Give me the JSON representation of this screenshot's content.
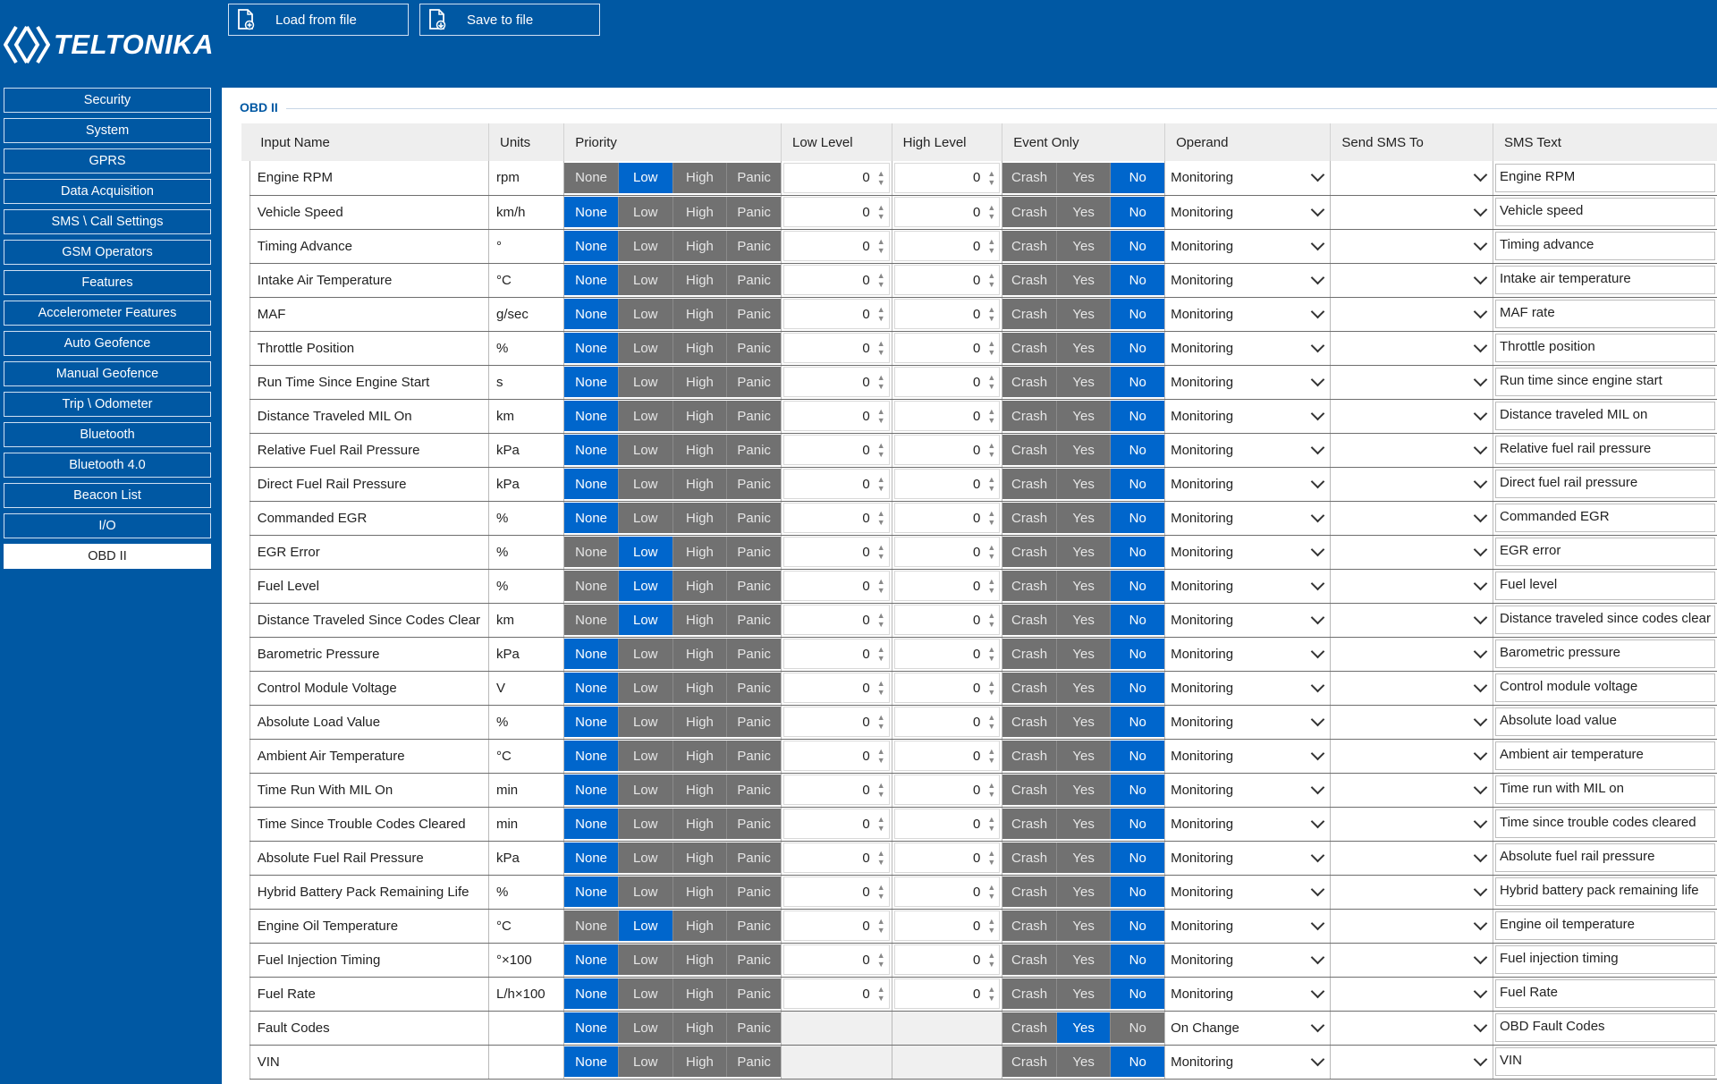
{
  "brand": {
    "logo_text": "TELTONIKA"
  },
  "toolbar": {
    "load_label": "Load from file",
    "save_label": "Save to file"
  },
  "sidebar": {
    "items": [
      "Security",
      "System",
      "GPRS",
      "Data Acquisition",
      "SMS \\ Call Settings",
      "GSM Operators",
      "Features",
      "Accelerometer Features",
      "Auto Geofence",
      "Manual Geofence",
      "Trip \\ Odometer",
      "Bluetooth",
      "Bluetooth 4.0",
      "Beacon List",
      "I/O",
      "OBD II"
    ],
    "active": "OBD II"
  },
  "panel": {
    "legend": "OBD II"
  },
  "table": {
    "headers": {
      "input_name": "Input Name",
      "units": "Units",
      "priority": "Priority",
      "low_level": "Low Level",
      "high_level": "High Level",
      "event_only": "Event Only",
      "operand": "Operand",
      "send_sms_to": "Send SMS To",
      "sms_text": "SMS Text"
    },
    "priority_options": [
      "None",
      "Low",
      "High",
      "Panic"
    ],
    "event_options": [
      "Crash",
      "Yes",
      "No"
    ],
    "rows": [
      {
        "name": "Engine RPM",
        "unit": "rpm",
        "priority": "Low",
        "low": "0",
        "high": "0",
        "event": "No",
        "operand": "Monitoring",
        "sms": "Engine RPM"
      },
      {
        "name": "Vehicle Speed",
        "unit": "km/h",
        "priority": "None",
        "low": "0",
        "high": "0",
        "event": "No",
        "operand": "Monitoring",
        "sms": "Vehicle speed"
      },
      {
        "name": "Timing Advance",
        "unit": "°",
        "priority": "None",
        "low": "0",
        "high": "0",
        "event": "No",
        "operand": "Monitoring",
        "sms": "Timing advance"
      },
      {
        "name": "Intake Air Temperature",
        "unit": "°C",
        "priority": "None",
        "low": "0",
        "high": "0",
        "event": "No",
        "operand": "Monitoring",
        "sms": "Intake air temperature"
      },
      {
        "name": "MAF",
        "unit": "g/sec",
        "priority": "None",
        "low": "0",
        "high": "0",
        "event": "No",
        "operand": "Monitoring",
        "sms": "MAF rate"
      },
      {
        "name": "Throttle Position",
        "unit": "%",
        "priority": "None",
        "low": "0",
        "high": "0",
        "event": "No",
        "operand": "Monitoring",
        "sms": "Throttle position"
      },
      {
        "name": "Run Time Since Engine Start",
        "unit": "s",
        "priority": "None",
        "low": "0",
        "high": "0",
        "event": "No",
        "operand": "Monitoring",
        "sms": "Run time since engine start"
      },
      {
        "name": "Distance Traveled MIL On",
        "unit": "km",
        "priority": "None",
        "low": "0",
        "high": "0",
        "event": "No",
        "operand": "Monitoring",
        "sms": "Distance traveled MIL on"
      },
      {
        "name": "Relative Fuel Rail Pressure",
        "unit": "kPa",
        "priority": "None",
        "low": "0",
        "high": "0",
        "event": "No",
        "operand": "Monitoring",
        "sms": "Relative fuel rail pressure"
      },
      {
        "name": "Direct Fuel Rail Pressure",
        "unit": "kPa",
        "priority": "None",
        "low": "0",
        "high": "0",
        "event": "No",
        "operand": "Monitoring",
        "sms": "Direct fuel rail pressure"
      },
      {
        "name": "Commanded EGR",
        "unit": "%",
        "priority": "None",
        "low": "0",
        "high": "0",
        "event": "No",
        "operand": "Monitoring",
        "sms": "Commanded EGR"
      },
      {
        "name": "EGR Error",
        "unit": "%",
        "priority": "Low",
        "low": "0",
        "high": "0",
        "event": "No",
        "operand": "Monitoring",
        "sms": "EGR error"
      },
      {
        "name": "Fuel Level",
        "unit": "%",
        "priority": "Low",
        "low": "0",
        "high": "0",
        "event": "No",
        "operand": "Monitoring",
        "sms": "Fuel level"
      },
      {
        "name": "Distance Traveled Since Codes Clear",
        "unit": "km",
        "priority": "Low",
        "low": "0",
        "high": "0",
        "event": "No",
        "operand": "Monitoring",
        "sms": "Distance traveled since codes clear"
      },
      {
        "name": "Barometric Pressure",
        "unit": "kPa",
        "priority": "None",
        "low": "0",
        "high": "0",
        "event": "No",
        "operand": "Monitoring",
        "sms": "Barometric pressure"
      },
      {
        "name": "Control Module Voltage",
        "unit": "V",
        "priority": "None",
        "low": "0",
        "high": "0",
        "event": "No",
        "operand": "Monitoring",
        "sms": "Control module voltage"
      },
      {
        "name": "Absolute Load Value",
        "unit": "%",
        "priority": "None",
        "low": "0",
        "high": "0",
        "event": "No",
        "operand": "Monitoring",
        "sms": "Absolute load value"
      },
      {
        "name": "Ambient Air Temperature",
        "unit": "°C",
        "priority": "None",
        "low": "0",
        "high": "0",
        "event": "No",
        "operand": "Monitoring",
        "sms": "Ambient air temperature"
      },
      {
        "name": "Time Run With MIL On",
        "unit": "min",
        "priority": "None",
        "low": "0",
        "high": "0",
        "event": "No",
        "operand": "Monitoring",
        "sms": "Time run with MIL on"
      },
      {
        "name": "Time Since Trouble Codes Cleared",
        "unit": "min",
        "priority": "None",
        "low": "0",
        "high": "0",
        "event": "No",
        "operand": "Monitoring",
        "sms": "Time since trouble codes cleared"
      },
      {
        "name": "Absolute Fuel Rail Pressure",
        "unit": "kPa",
        "priority": "None",
        "low": "0",
        "high": "0",
        "event": "No",
        "operand": "Monitoring",
        "sms": "Absolute fuel rail pressure"
      },
      {
        "name": "Hybrid Battery Pack Remaining Life",
        "unit": "%",
        "priority": "None",
        "low": "0",
        "high": "0",
        "event": "No",
        "operand": "Monitoring",
        "sms": "Hybrid battery pack remaining life"
      },
      {
        "name": "Engine Oil Temperature",
        "unit": "°C",
        "priority": "Low",
        "low": "0",
        "high": "0",
        "event": "No",
        "operand": "Monitoring",
        "sms": "Engine oil temperature"
      },
      {
        "name": "Fuel Injection Timing",
        "unit": "°×100",
        "priority": "None",
        "low": "0",
        "high": "0",
        "event": "No",
        "operand": "Monitoring",
        "sms": "Fuel injection timing"
      },
      {
        "name": "Fuel Rate",
        "unit": "L/h×100",
        "priority": "None",
        "low": "0",
        "high": "0",
        "event": "No",
        "operand": "Monitoring",
        "sms": "Fuel Rate"
      },
      {
        "name": "Fault Codes",
        "unit": "",
        "priority": "None",
        "low": "",
        "high": "",
        "event": "Yes",
        "operand": "On Change",
        "sms": "OBD Fault Codes"
      },
      {
        "name": "VIN",
        "unit": "",
        "priority": "None",
        "low": "",
        "high": "",
        "event": "No",
        "operand": "Monitoring",
        "sms": "VIN"
      }
    ]
  },
  "colors": {
    "brand_blue": "#0058a3",
    "selected_blue": "#0066cc",
    "unselected_gray": "#717171"
  }
}
